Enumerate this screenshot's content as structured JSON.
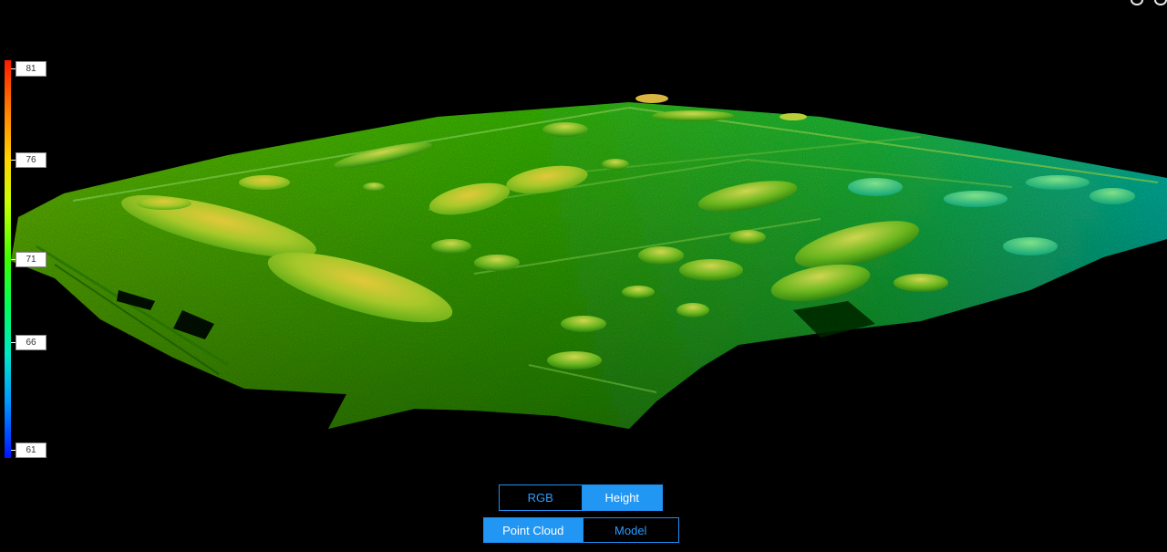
{
  "legend": {
    "title": "",
    "ticks": [
      {
        "label": "81"
      },
      {
        "label": "76"
      },
      {
        "label": "71"
      },
      {
        "label": "66"
      },
      {
        "label": "61"
      }
    ],
    "min": 61,
    "max": 81,
    "colors": [
      "#ff1a00",
      "#ffd400",
      "#3cff00",
      "#00e6c8",
      "#0014ff"
    ]
  },
  "color_mode": {
    "options": [
      {
        "label": "RGB",
        "active": false
      },
      {
        "label": "Height",
        "active": true
      }
    ]
  },
  "view_mode": {
    "options": [
      {
        "label": "Point Cloud",
        "active": true
      },
      {
        "label": "Model",
        "active": false
      }
    ]
  },
  "colors": {
    "accent": "#2196f3",
    "background": "#000000"
  }
}
